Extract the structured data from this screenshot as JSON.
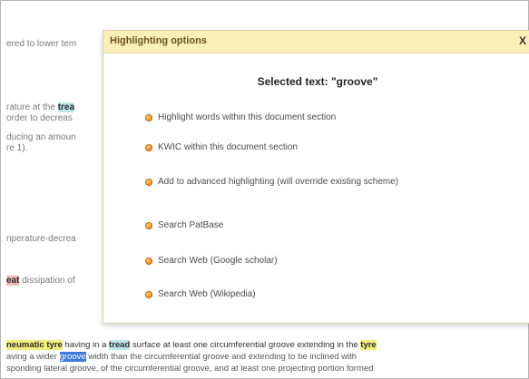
{
  "background": {
    "lines": [
      {
        "pre": "ered to lower tem",
        "hl": "",
        "hlclass": "",
        "post": ""
      },
      {
        "pre": "rature at the ",
        "hl": "trea",
        "hlclass": "hl-teal",
        "post": ""
      },
      {
        "pre": "order to decreas",
        "hl": "",
        "hlclass": "",
        "post": ""
      },
      {
        "pre": "ducing an amoun",
        "hl": "",
        "hlclass": "",
        "post": ""
      },
      {
        "pre": "re 1).",
        "hl": "",
        "hlclass": "",
        "post": ""
      },
      {
        "pre": "nperature-decrea",
        "hl": "",
        "hlclass": "",
        "post": ""
      },
      {
        "pre": "",
        "hl": "eat",
        "hlclass": "hl-red",
        "post": " dissipation of"
      }
    ],
    "bottom": [
      {
        "parts": [
          {
            "text": "neumatic ",
            "cls": "hl-yellow"
          },
          {
            "text": "tyre",
            "cls": "hl-yellow"
          },
          {
            "text": " having in a ",
            "cls": ""
          },
          {
            "text": "tread",
            "cls": "hl-teal"
          },
          {
            "text": " surface at least one circumferential groove extending in the ",
            "cls": ""
          },
          {
            "text": "tyre",
            "cls": "hl-yellow"
          }
        ]
      },
      {
        "parts": [
          {
            "text": "aving a wider ",
            "cls": ""
          },
          {
            "text": "groove",
            "cls": "hl-blue"
          },
          {
            "text": " width than the circumferential groove and extending to be inclined with",
            "cls": ""
          }
        ]
      },
      {
        "parts": [
          {
            "text": "sponding lateral groove, of the circumferential groove, and at least one projecting portion formed",
            "cls": ""
          }
        ]
      }
    ]
  },
  "dialog": {
    "title": "Highlighting options",
    "close_label": "X",
    "selected_text": "Selected text: \"groove\"",
    "options": [
      {
        "label": "Highlight words within this document section"
      },
      {
        "label": "KWIC within this document section"
      },
      {
        "label": "Add to advanced highlighting (will override existing scheme)"
      },
      {
        "label": "Search PatBase"
      },
      {
        "label": "Search Web (Google scholar)"
      },
      {
        "label": "Search Web (Wikipedia)"
      }
    ]
  }
}
